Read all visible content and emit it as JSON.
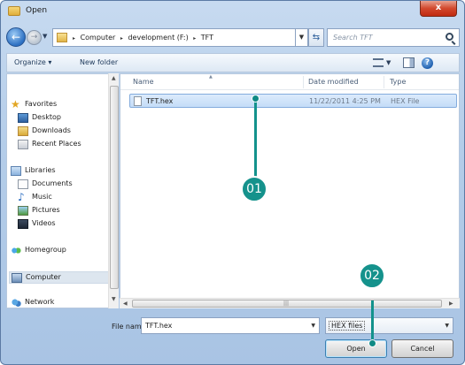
{
  "window": {
    "title": "Open",
    "close_glyph": "x"
  },
  "address": {
    "crumbs": [
      "Computer",
      "development (F:)",
      "TFT"
    ],
    "separator": "▸",
    "search_placeholder": "Search TFT"
  },
  "toolbar": {
    "organize": "Organize ▾",
    "new_folder": "New folder",
    "help": "?"
  },
  "nav": {
    "items": [
      {
        "label": "Favorites",
        "icon": "star-icon"
      },
      {
        "label": "Desktop",
        "icon": "desktop-icon"
      },
      {
        "label": "Downloads",
        "icon": "downloads-icon"
      },
      {
        "label": "Recent Places",
        "icon": "recent-places-icon"
      },
      {
        "label": "Libraries",
        "icon": "libraries-icon"
      },
      {
        "label": "Documents",
        "icon": "documents-icon"
      },
      {
        "label": "Music",
        "icon": "music-icon"
      },
      {
        "label": "Pictures",
        "icon": "pictures-icon"
      },
      {
        "label": "Videos",
        "icon": "videos-icon"
      },
      {
        "label": "Homegroup",
        "icon": "homegroup-icon"
      },
      {
        "label": "Computer",
        "icon": "computer-icon"
      },
      {
        "label": "Network",
        "icon": "network-icon"
      }
    ]
  },
  "columns": {
    "name": "Name",
    "date": "Date modified",
    "type": "Type"
  },
  "files": [
    {
      "name": "TFT.hex",
      "date": "11/22/2011 4:25 PM",
      "type": "HEX File"
    }
  ],
  "bottom": {
    "file_name_label": "File name:",
    "file_name_value": "TFT.hex",
    "file_type": "HEX files",
    "open": "Open",
    "cancel": "Cancel"
  },
  "annotations": {
    "step1": "01",
    "step2": "02",
    "color": "#15928c"
  }
}
